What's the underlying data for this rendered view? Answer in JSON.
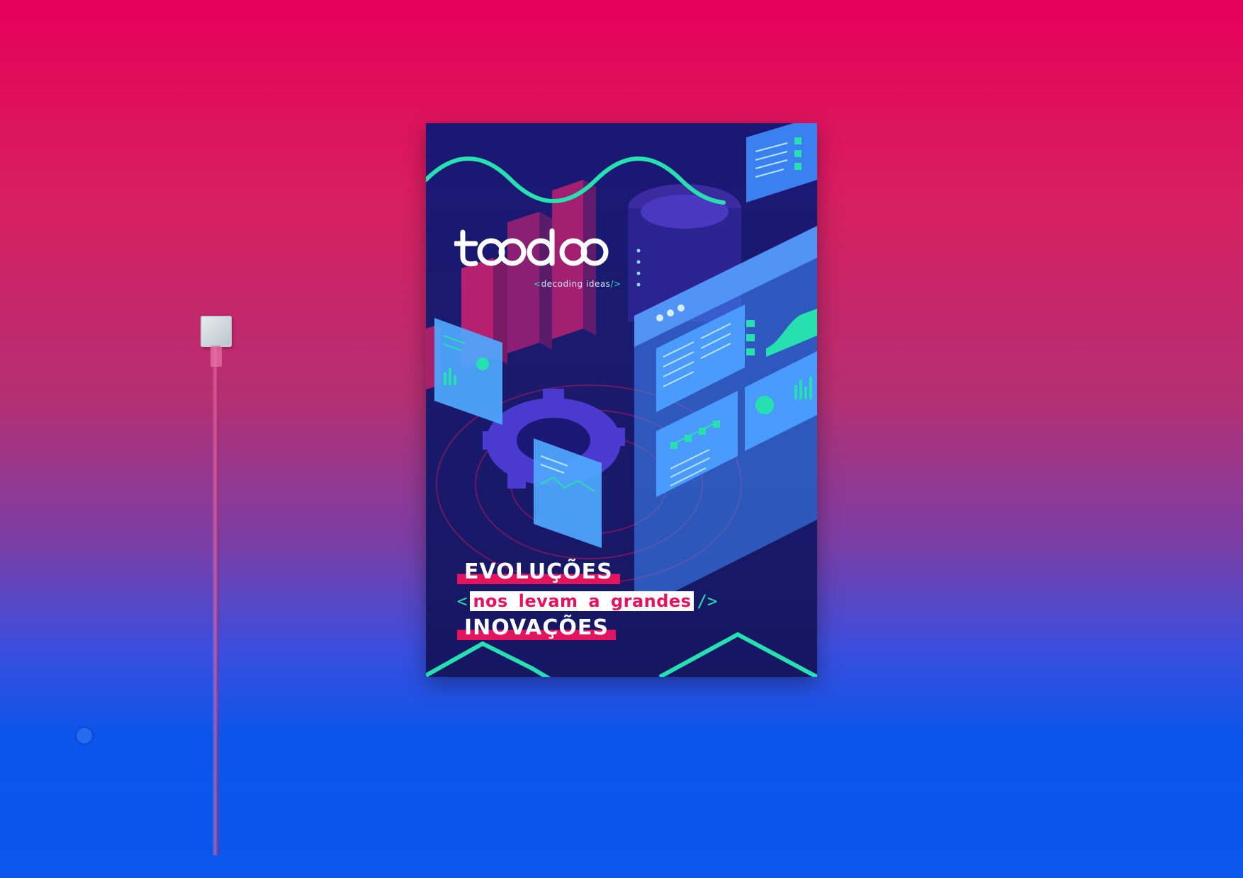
{
  "scene": {
    "wall_colors": [
      "#e6005a",
      "#0a57ec"
    ]
  },
  "poster": {
    "logo_text": "toodoo",
    "tagline_open": "<",
    "tagline": "decoding ideas",
    "tagline_close": "/>",
    "headline_1": "EVOLUÇÕES",
    "headline_open": "<",
    "headline_2": "nos levam a grandes",
    "headline_close": "/>",
    "headline_3": "INOVAÇÕES",
    "colors": {
      "background": "#1b1875",
      "accent_green": "#27e0b0",
      "accent_pink": "#e3135e",
      "panel_blue": "#3f8cff"
    }
  }
}
